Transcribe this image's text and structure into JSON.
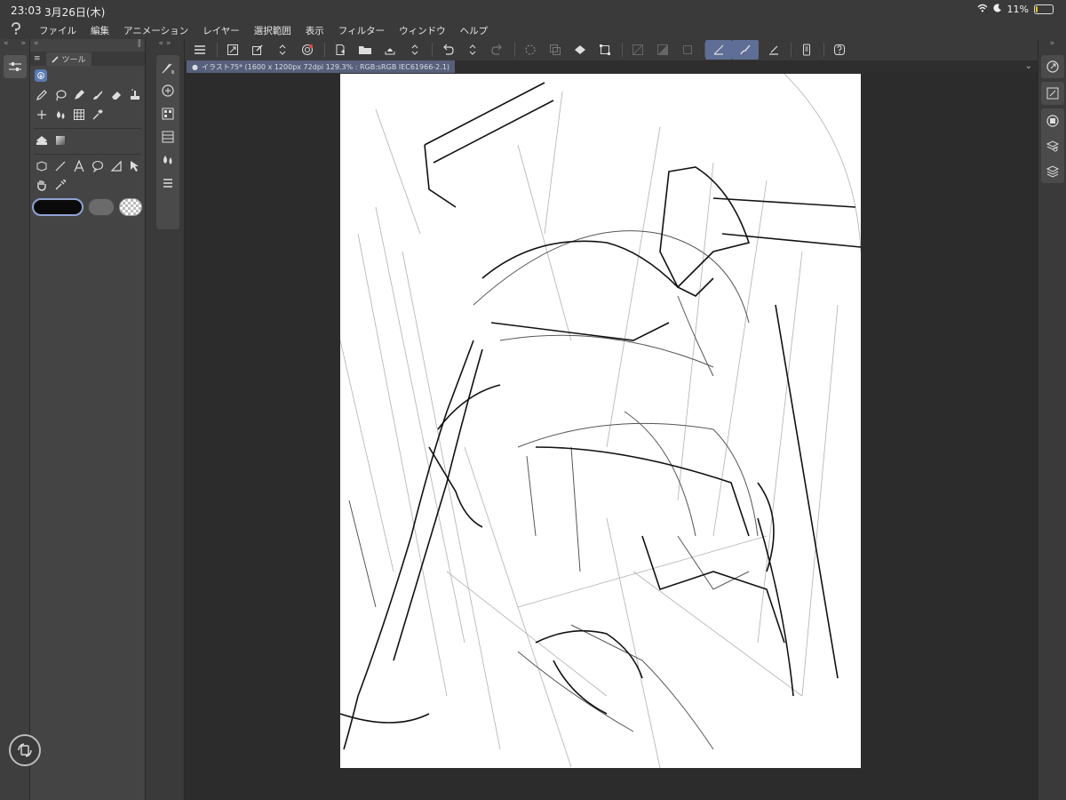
{
  "status": {
    "time": "23:03",
    "date": "3月26日(木)",
    "battery_text": "11%",
    "battery_level": 0.11
  },
  "menu": {
    "items": [
      "ファイル",
      "編集",
      "アニメーション",
      "レイヤー",
      "選択範囲",
      "表示",
      "フィルター",
      "ウィンドウ",
      "ヘルプ"
    ]
  },
  "tool_panel": {
    "tab_label": "ツール"
  },
  "document": {
    "tab_label": "イラスト75* (1600 x 1200px 72dpi 129.3% : RGB:sRGB IEC61966-2.1)"
  },
  "colors": {
    "main": "#0a0a0a",
    "sub": "#6b6b6b",
    "accent": "#5e6e96"
  }
}
